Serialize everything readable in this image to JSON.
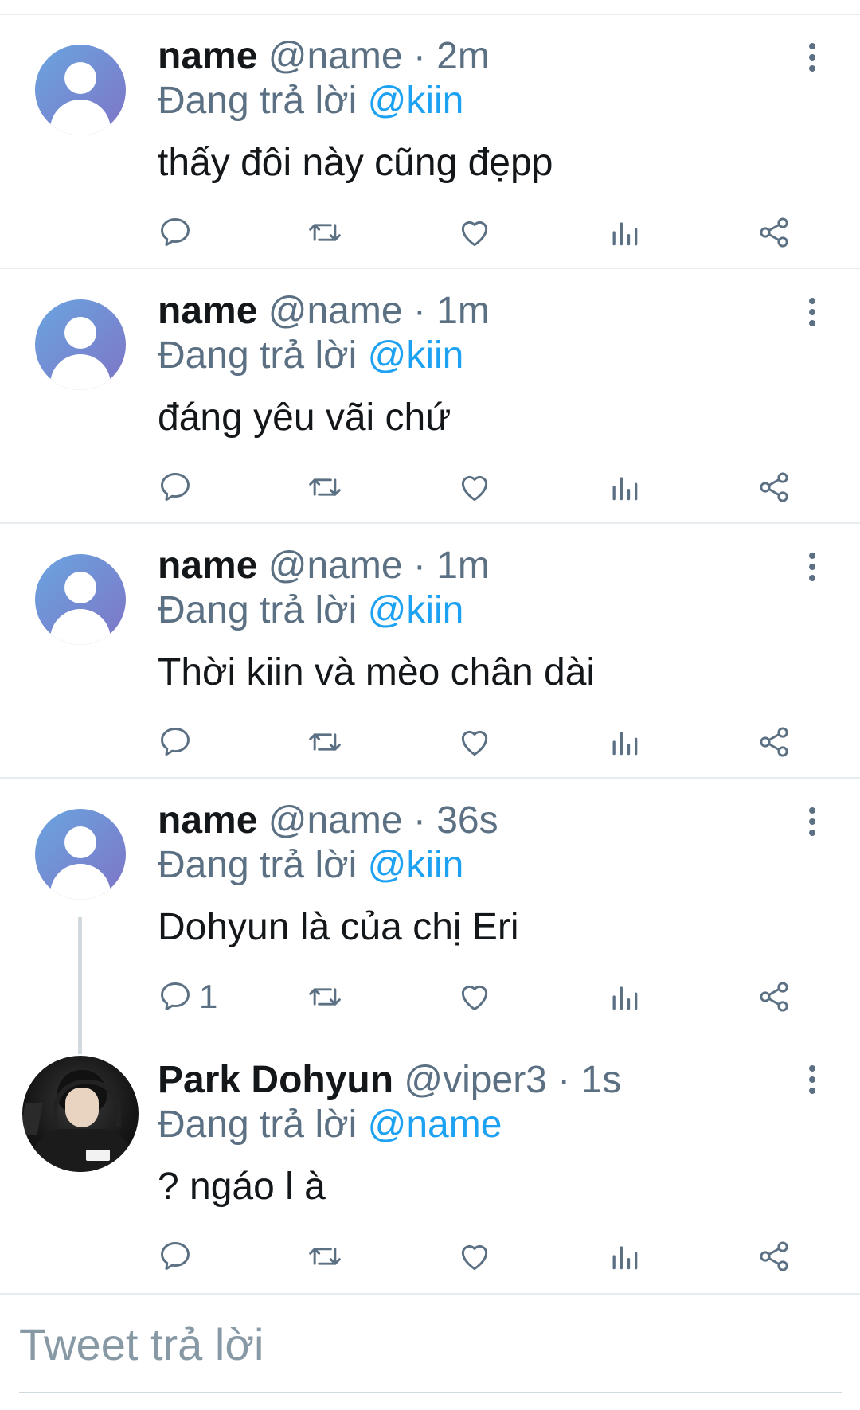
{
  "replies": [
    {
      "name": "name",
      "handle": "@name",
      "dot": "·",
      "time": "2m",
      "replying": "Đang trả lời",
      "mention": "@kiin",
      "text": "thấy đôi này cũng đẹpp",
      "reply_count": ""
    },
    {
      "name": "name",
      "handle": "@name",
      "dot": "·",
      "time": "1m",
      "replying": "Đang trả lời",
      "mention": "@kiin",
      "text": "đáng yêu vãi chứ",
      "reply_count": ""
    },
    {
      "name": "name",
      "handle": "@name",
      "dot": "·",
      "time": "1m",
      "replying": "Đang trả lời",
      "mention": "@kiin",
      "text": "Thời kiin và mèo chân dài",
      "reply_count": ""
    },
    {
      "name": "name",
      "handle": "@name",
      "dot": "·",
      "time": "36s",
      "replying": "Đang trả lời",
      "mention": "@kiin",
      "text": "Dohyun là của chị Eri",
      "reply_count": "1"
    },
    {
      "name": "Park Dohyun",
      "handle": "@viper3",
      "dot": "·",
      "time": "1s",
      "replying": "Đang trả lời",
      "mention": "@name",
      "text": "? ngáo l à",
      "reply_count": ""
    }
  ],
  "reply_box": {
    "placeholder": "Tweet trả lời"
  },
  "icons": [
    "reply-icon",
    "retweet-icon",
    "like-icon",
    "analytics-icon",
    "share-icon",
    "more-icon",
    "default-avatar-icon"
  ],
  "colors": {
    "mention": "#1da1f2",
    "secondary": "#5b7083",
    "text": "#14171a",
    "divider": "#e6ecf0"
  }
}
